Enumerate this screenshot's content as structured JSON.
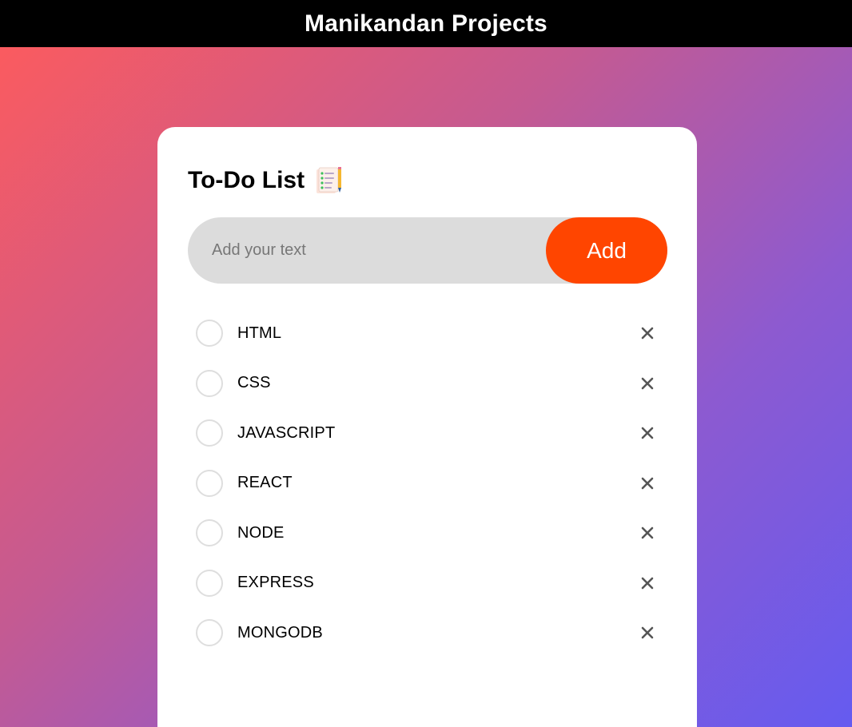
{
  "header": {
    "title": "Manikandan Projects"
  },
  "card": {
    "title": "To-Do List",
    "title_icon": "notes-with-pencil-icon"
  },
  "input": {
    "placeholder": "Add your text",
    "value": ""
  },
  "add_button": {
    "label": "Add"
  },
  "todos": [
    {
      "label": "HTML",
      "checked": false
    },
    {
      "label": "CSS",
      "checked": false
    },
    {
      "label": "JAVASCRIPT",
      "checked": false
    },
    {
      "label": "REACT",
      "checked": false
    },
    {
      "label": "NODE",
      "checked": false
    },
    {
      "label": "EXPRESS",
      "checked": false
    },
    {
      "label": "MONGODB",
      "checked": false
    }
  ],
  "icons": {
    "checkbox": "circle-checkbox-icon",
    "delete": "close-icon"
  },
  "colors": {
    "accent": "#ff4500",
    "header_bg": "#000000",
    "gradient_start": "#ff5b5b",
    "gradient_end": "#655bf0"
  }
}
